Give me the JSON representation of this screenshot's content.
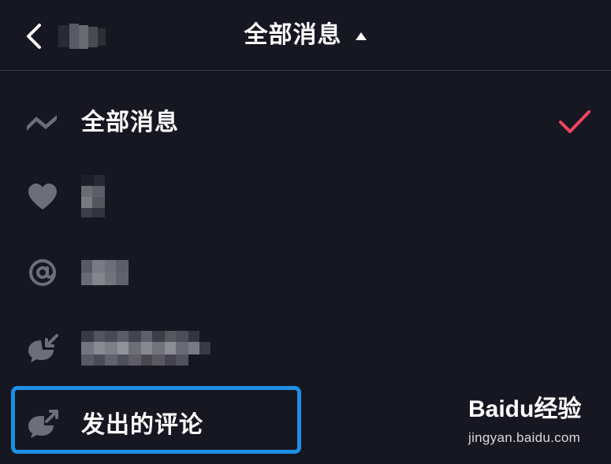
{
  "header": {
    "title": "全部消息"
  },
  "menu": {
    "items": [
      {
        "label": "全部消息",
        "icon": "trend-wave-icon",
        "selected": true
      },
      {
        "label": "",
        "icon": "heart-icon",
        "selected": false
      },
      {
        "label": "",
        "icon": "at-sign-icon",
        "selected": false
      },
      {
        "label": "",
        "icon": "comment-received-icon",
        "selected": false
      },
      {
        "label": "发出的评论",
        "icon": "comment-sent-icon",
        "selected": false
      }
    ]
  },
  "watermark": {
    "logo": "Baidu经验",
    "url": "jingyan.baidu.com"
  },
  "colors": {
    "background": "#171722",
    "check": "#f0455f",
    "highlight": "#1e8fe6",
    "icon": "#6e6e78"
  }
}
